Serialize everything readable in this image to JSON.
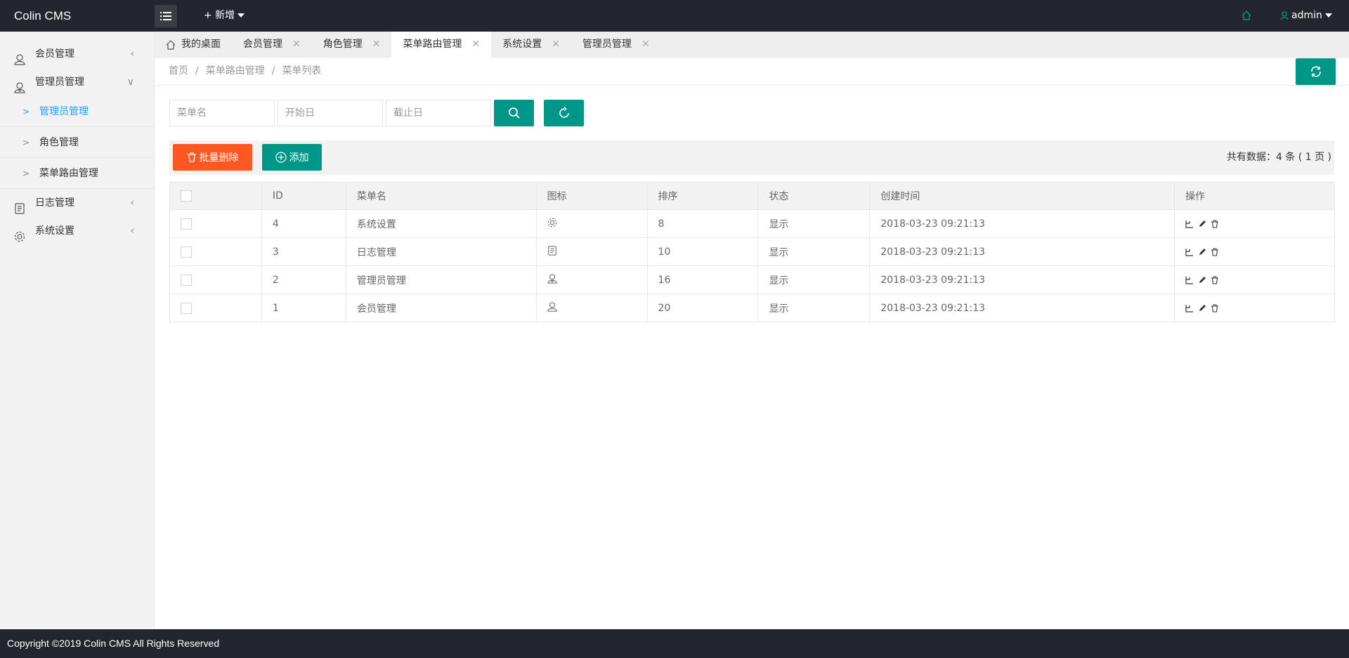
{
  "app": {
    "logo": "Colin CMS",
    "add_new": "+ 新增",
    "user": "admin"
  },
  "sidebar": {
    "items": [
      {
        "label": "会员管理",
        "icon": "user-icon",
        "arrow": "<"
      },
      {
        "label": "管理员管理",
        "icon": "admin-user-icon",
        "arrow": "∨"
      },
      {
        "label": "日志管理",
        "icon": "log-icon",
        "arrow": "<"
      },
      {
        "label": "系统设置",
        "icon": "gear-icon",
        "arrow": "<"
      }
    ],
    "sub_items": [
      {
        "label": "管理员管理"
      },
      {
        "label": "角色管理"
      },
      {
        "label": "菜单路由管理"
      }
    ]
  },
  "tabs": [
    {
      "label": "我的桌面"
    },
    {
      "label": "会员管理"
    },
    {
      "label": "角色管理"
    },
    {
      "label": "菜单路由管理"
    },
    {
      "label": "系统设置"
    },
    {
      "label": "管理员管理"
    }
  ],
  "breadcrumb": [
    "首页",
    "菜单路由管理",
    "菜单列表"
  ],
  "search": {
    "name_placeholder": "菜单名",
    "start_placeholder": "开始日",
    "end_placeholder": "截止日"
  },
  "toolbar": {
    "batch_delete": "批量删除",
    "add": "添加",
    "total": "共有数据：4 条 ( 1 页 )"
  },
  "table": {
    "headers": [
      "ID",
      "菜单名",
      "图标",
      "排序",
      "状态",
      "创建时间",
      "操作"
    ],
    "rows": [
      {
        "id": "4",
        "name": "系统设置",
        "icon": "gear-icon",
        "sort": "8",
        "status": "显示",
        "created": "2018-03-23 09:21:13"
      },
      {
        "id": "3",
        "name": "日志管理",
        "icon": "log-icon",
        "sort": "10",
        "status": "显示",
        "created": "2018-03-23 09:21:13"
      },
      {
        "id": "2",
        "name": "管理员管理",
        "icon": "admin-user-icon",
        "sort": "16",
        "status": "显示",
        "created": "2018-03-23 09:21:13"
      },
      {
        "id": "1",
        "name": "会员管理",
        "icon": "user-icon",
        "sort": "20",
        "status": "显示",
        "created": "2018-03-23 09:21:13"
      }
    ]
  },
  "footer": {
    "text": "Copyright ©2019 Colin CMS All Rights Reserved"
  },
  "colors": {
    "teal": "#009688",
    "danger": "#ff5722",
    "header": "#23262e",
    "active_link": "#1e9fff"
  }
}
